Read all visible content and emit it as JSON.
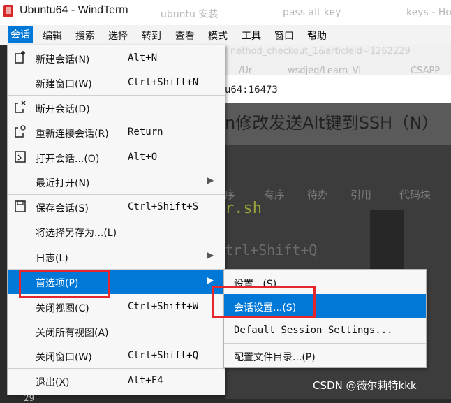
{
  "window": {
    "title": "Ubuntu64 - WindTerm"
  },
  "background": {
    "ghost_tabs": [
      "ubuntu 安装",
      "pass alt key",
      "keys - Ho"
    ],
    "ghost_url": "nethod_checkout_1&articleId=1262229",
    "ghost_bookmarks": [
      "/Ur",
      "wsdjeg/Learn_Vi",
      "CSAPP"
    ],
    "address": "u64:16473",
    "heading": "n修改发送Alt键到SSH（N）",
    "toolbar_labels": [
      "序",
      "有序",
      "待办",
      "引用",
      "代码块"
    ],
    "code_lines": [
      "r.sh",
      "trl+Shift+Q"
    ]
  },
  "menubar": {
    "items": [
      "会话",
      "编辑",
      "搜索",
      "选择",
      "转到",
      "查看",
      "模式",
      "工具",
      "窗口",
      "帮助"
    ]
  },
  "session_menu": {
    "items": [
      {
        "label": "新建会话(N)",
        "shortcut": "Alt+N"
      },
      {
        "label": "新建窗口(W)",
        "shortcut": "Ctrl+Shift+N"
      },
      {
        "label": "断开会话(D)",
        "shortcut": ""
      },
      {
        "label": "重新连接会话(R)",
        "shortcut": "Return"
      },
      {
        "label": "打开会话...(O)",
        "shortcut": "Alt+O"
      },
      {
        "label": "最近打开(N)",
        "shortcut": ""
      },
      {
        "label": "保存会话(S)",
        "shortcut": "Ctrl+Shift+S"
      },
      {
        "label": "将选择另存为...(L)",
        "shortcut": ""
      },
      {
        "label": "日志(L)",
        "shortcut": ""
      },
      {
        "label": "首选项(P)",
        "shortcut": ""
      },
      {
        "label": "关闭视图(C)",
        "shortcut": "Ctrl+Shift+W"
      },
      {
        "label": "关闭所有视图(A)",
        "shortcut": ""
      },
      {
        "label": "关闭窗口(W)",
        "shortcut": "Ctrl+Shift+Q"
      },
      {
        "label": "退出(X)",
        "shortcut": "Alt+F4"
      }
    ]
  },
  "preferences_submenu": {
    "items": [
      {
        "label": "设置...(S)"
      },
      {
        "label": "会话设置...(S)"
      },
      {
        "label": "Default Session Settings..."
      },
      {
        "label": "配置文件目录...(P)"
      }
    ]
  },
  "watermark": "CSDN @薇尔莉特kkk",
  "bottom_number": "29",
  "colors": {
    "accent": "#0078d7",
    "highlight_box": "#e6262a",
    "menu_bg": "#f7f7f7"
  }
}
